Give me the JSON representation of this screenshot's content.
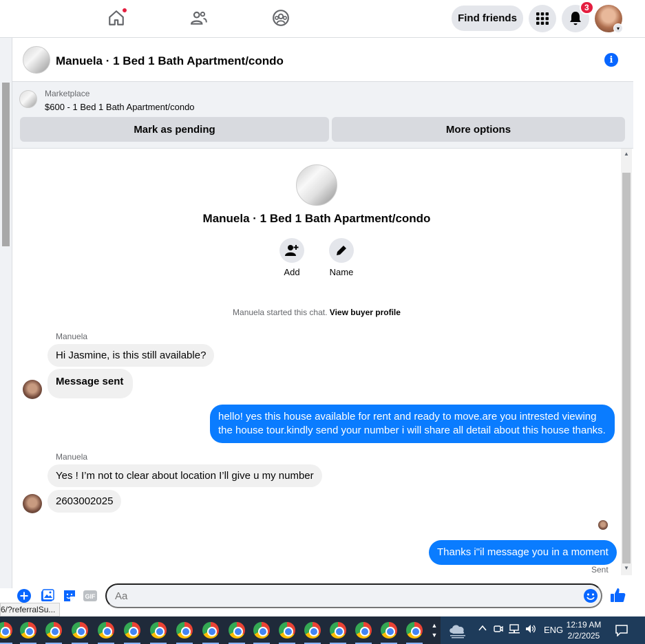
{
  "topnav": {
    "find_friends": "Find friends",
    "notification_count": "3"
  },
  "chat": {
    "title": "Manuela · 1 Bed 1 Bath Apartment/condo",
    "info_icon": "i"
  },
  "marketplace": {
    "label": "Marketplace",
    "listing": "$600 - 1 Bed 1 Bath Apartment/condo",
    "mark_pending": "Mark as pending",
    "more_options": "More options"
  },
  "intro": {
    "title": "Manuela · 1 Bed 1 Bath Apartment/condo",
    "add_label": "Add",
    "name_label": "Name",
    "started_text": "Manuela started this chat.",
    "view_profile": "View buyer profile"
  },
  "messages": {
    "sender_1": "Manuela",
    "m1": "Hi Jasmine, is this still available?",
    "m2": "Message sent",
    "m3": "hello! yes this house available for rent and ready to move.are you intrested viewing the house tour.kindly send your number i will share all detail about this house thanks.",
    "sender_2": "Manuela",
    "m4": "Yes ! I’m not to clear about location I’ll give u my number",
    "m5": "2603002025",
    "m6": "Thanks i\"il message you in a moment",
    "sent_status": "Sent"
  },
  "composer": {
    "placeholder": "Aa",
    "gif_label": "GIF"
  },
  "status_url": "6/?referralSu...",
  "taskbar": {
    "lang": "ENG",
    "time": "12:19 AM",
    "date": "2/2/2025"
  },
  "colors": {
    "accent": "#0866ff",
    "outgoing_bubble": "#0a7cff",
    "incoming_bubble": "#f0f0f0",
    "badge": "#e41e3f"
  }
}
